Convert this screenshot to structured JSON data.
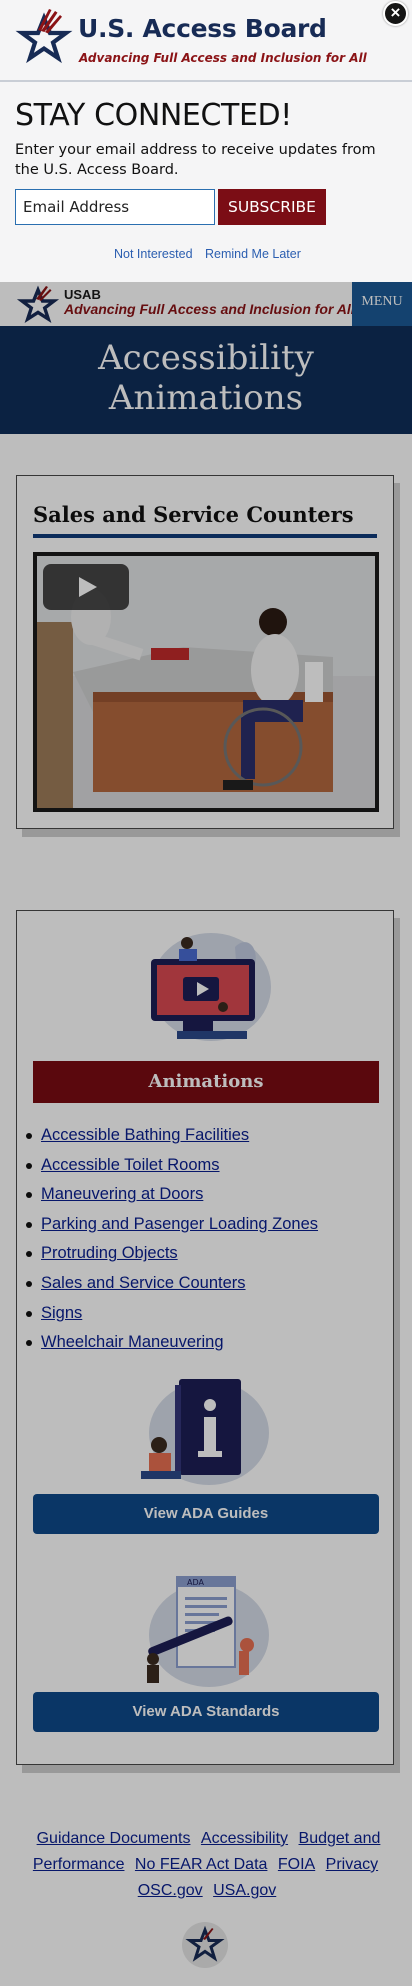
{
  "popup": {
    "logo_title": "U.S. Access Board",
    "logo_tagline": "Advancing Full Access and Inclusion for All",
    "heading": "STAY CONNECTED!",
    "description": "Enter your email address to receive updates from the U.S. Access Board.",
    "email_placeholder": "Email Address",
    "subscribe_label": "SUBSCRIBE",
    "not_interested_label": "Not Interested",
    "remind_later_label": "Remind Me Later",
    "close_icon": "close-icon"
  },
  "header": {
    "short_name": "USAB",
    "tagline": "Advancing Full Access and Inclusion for All",
    "menu_label": "MENU"
  },
  "hero": {
    "title_line1": "Accessibility",
    "title_line2": "Animations"
  },
  "video_card": {
    "title": "Sales and Service Counters",
    "play_icon": "play-icon"
  },
  "animations_card": {
    "heading": "Animations",
    "items": [
      "Accessible Bathing Facilities",
      "Accessible Toilet Rooms",
      "Maneuvering at Doors",
      "Parking and Pasenger Loading Zones",
      "Protruding Objects",
      "Sales and Service Counters",
      "Signs",
      "Wheelchair Maneuvering"
    ],
    "guides_button": "View ADA Guides",
    "standards_button": "View ADA Standards",
    "standards_doc_label": "ADA"
  },
  "footer": {
    "links": [
      "Guidance Documents",
      "Accessibility",
      "Budget and Performance",
      "No FEAR Act Data",
      "FOIA",
      "Privacy",
      "OSC.gov",
      "USA.gov"
    ]
  },
  "colors": {
    "navy": "#102e5a",
    "maroon": "#7b0d15",
    "button_blue": "#0e4a8a",
    "link_blue": "#0a1f8f"
  }
}
